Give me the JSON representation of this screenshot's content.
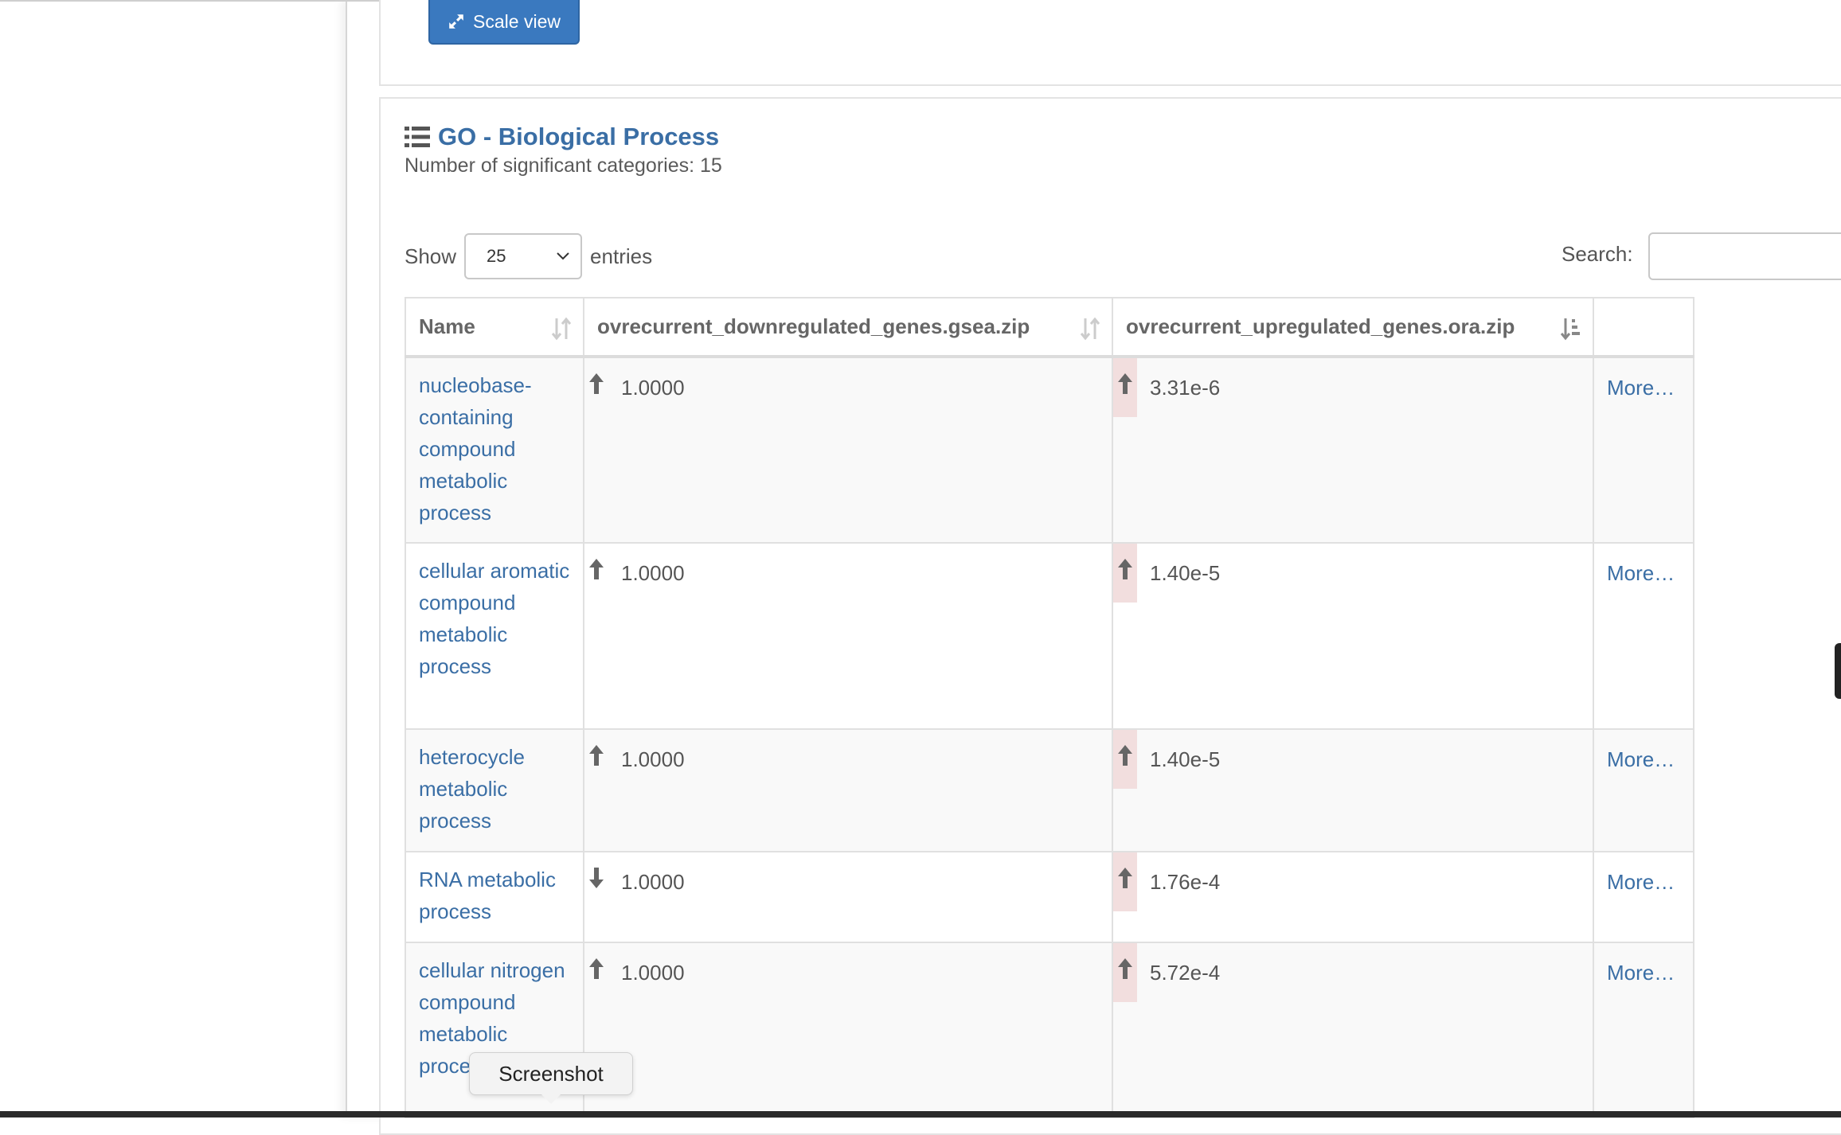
{
  "toolbar": {
    "scale_view_label": "Scale view"
  },
  "section": {
    "title": "GO - Biological Process",
    "significant_count": "Number of significant categories: 15"
  },
  "controls": {
    "show_label": "Show",
    "entries_label": "entries",
    "page_size": "25",
    "search_label": "Search:",
    "search_value": ""
  },
  "table": {
    "headers": [
      "Name",
      "ovrecurrent_downregulated_genes.gsea.zip",
      "ovrecurrent_upregulated_genes.ora.zip",
      ""
    ],
    "rows": [
      {
        "name": "nucleobase-containing compound metabolic process",
        "down_dir": "up",
        "down_val": "1.0000",
        "up_dir": "up",
        "up_val": "3.31e-6",
        "more": "More…"
      },
      {
        "name": "cellular aromatic compound metabolic process",
        "down_dir": "up",
        "down_val": "1.0000",
        "up_dir": "up",
        "up_val": "1.40e-5",
        "more": "More…"
      },
      {
        "name": "heterocycle metabolic process",
        "down_dir": "up",
        "down_val": "1.0000",
        "up_dir": "up",
        "up_val": "1.40e-5",
        "more": "More…"
      },
      {
        "name": "RNA metabolic process",
        "down_dir": "down",
        "down_val": "1.0000",
        "up_dir": "up",
        "up_val": "1.76e-4",
        "more": "More…"
      },
      {
        "name": "cellular nitrogen compound metabolic process",
        "down_dir": "up",
        "down_val": "1.0000",
        "up_dir": "up",
        "up_val": "5.72e-4",
        "more": "More…"
      }
    ]
  },
  "tooltip": {
    "label": "Screenshot"
  },
  "colors": {
    "accent": "#3a79bf",
    "link": "#3a6ea5",
    "highlight": "#f2dede"
  }
}
